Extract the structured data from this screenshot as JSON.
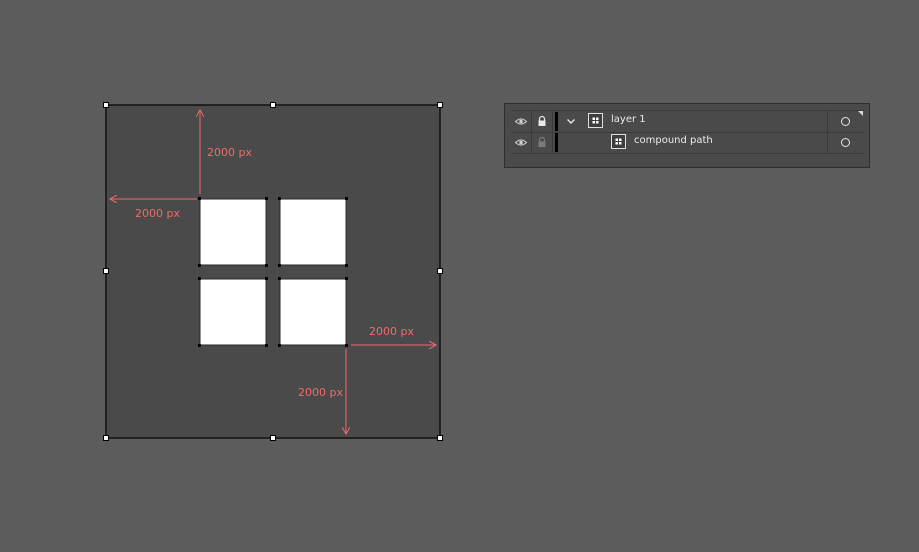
{
  "canvas": {
    "dimension_labels": {
      "top": "2000 px",
      "left": "2000 px",
      "right": "2000 px",
      "bottom": "2000 px"
    },
    "colors": {
      "workspace": "#5c5c5c",
      "artboard": "#4a4a4a",
      "square": "#ffffff",
      "dimension": "#f06b6b"
    }
  },
  "layers_panel": {
    "rows": [
      {
        "label": "layer 1",
        "icons": [
          "eye-icon",
          "lock-icon",
          "chevron-down-icon",
          "layer-thumbnail"
        ]
      },
      {
        "label": "compound path",
        "icons": [
          "eye-icon",
          "lock-icon",
          "path-thumbnail"
        ]
      }
    ]
  }
}
